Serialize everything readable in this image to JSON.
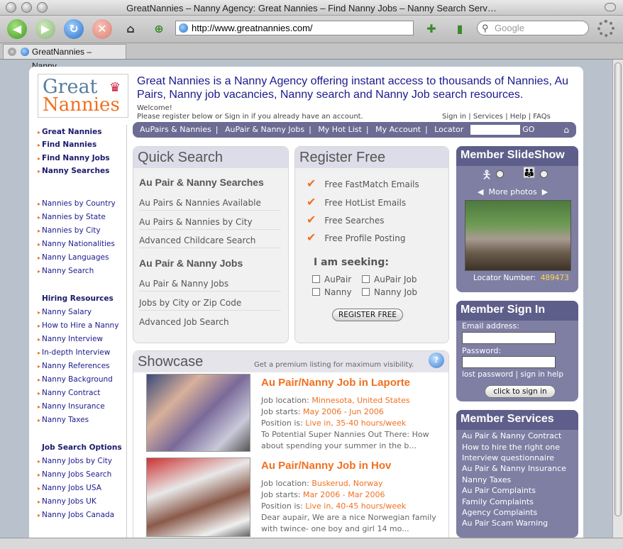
{
  "browser": {
    "window_title": "GreatNannies – Nanny Agency: Great Nannies – Find Nanny Jobs – Nanny Search Serv…",
    "url": "http://www.greatnannies.com/",
    "search_placeholder": "Google",
    "tab_title": "GreatNannies – Nanny…"
  },
  "logo": {
    "line1": "Great",
    "line2": "Nannies"
  },
  "header": {
    "headline": "Great Nannies is a Nanny Agency offering instant access to thousands of Nannies, Au Pairs, Nanny job vacancies, Nanny search and Nanny Job search resources.",
    "welcome": "Welcome!",
    "register_note": "Please register below or Sign in if you already have an account.",
    "top_links": [
      "Sign in",
      "Services",
      "Help",
      "FAQs"
    ]
  },
  "navbar": {
    "items": [
      "AuPairs & Nannies",
      "AuPair & Nanny Jobs",
      "My Hot List",
      "My Account",
      "Locator"
    ],
    "go_label": "GO"
  },
  "leftnav": {
    "main": [
      "Great Nannies",
      "Find Nannies",
      "Find Nanny Jobs",
      "Nanny Searches"
    ],
    "browse": [
      "Nannies by Country",
      "Nannies by State",
      "Nannies by City",
      "Nanny Nationalities",
      "Nanny Languages",
      "Nanny Search"
    ],
    "hiring_header": "Hiring Resources",
    "hiring": [
      "Nanny Salary",
      "How to Hire a Nanny",
      "Nanny Interview",
      "In-depth Interview",
      "Nanny References",
      "Nanny Background",
      "Nanny Contract",
      "Nanny Insurance",
      "Nanny Taxes"
    ],
    "jobs_header": "Job Search Options",
    "jobs": [
      "Nanny Jobs by City",
      "Nanny Jobs Search",
      "Nanny Jobs USA",
      "Nanny Jobs UK",
      "Nanny Jobs Canada"
    ]
  },
  "quick_search": {
    "title": "Quick Search",
    "section1": "Au Pair & Nanny Searches",
    "items1": [
      "Au Pairs & Nannies Available",
      "Au Pairs & Nannies by City",
      "Advanced Childcare Search"
    ],
    "section2": "Au Pair & Nanny Jobs",
    "items2": [
      "Au Pair & Nanny Jobs",
      "Jobs by City or Zip Code",
      "Advanced Job Search"
    ]
  },
  "register": {
    "title": "Register Free",
    "benefits": [
      "Free FastMatch Emails",
      "Free HotList Emails",
      "Free Searches",
      "Free Profile Posting"
    ],
    "seeking_label": "I am seeking:",
    "options": [
      "AuPair",
      "AuPair Job",
      "Nanny",
      "Nanny Job"
    ],
    "button": "REGISTER FREE"
  },
  "showcase": {
    "title": "Showcase",
    "premium_note": "Get a premium listing for maximum visibility.",
    "labels": {
      "location": "Job location:",
      "starts": "Job starts:",
      "position": "Position is:"
    },
    "jobs": [
      {
        "title": "Au Pair/Nanny Job  in Laporte",
        "location": "Minnesota, United States",
        "starts": "May 2006 - Jun 2006",
        "position": "Live in, 35-40 hours/week",
        "desc1": "To Potential Super Nannies Out There: How",
        "desc2": "about spending your summer in the b..."
      },
      {
        "title": "Au Pair/Nanny Job  in Hov",
        "location": "Buskerud, Norway",
        "starts": "Mar 2006 - Mar 2006",
        "position": "Live in, 40-45 hours/week",
        "desc1": "Dear aupair, We are a nice Norwegian family",
        "desc2": "with twince- one boy and girl 14 mo..."
      }
    ]
  },
  "slideshow": {
    "title": "Member SlideShow",
    "more_photos": "More photos",
    "locator_label": "Locator Number:",
    "locator_number": "489473"
  },
  "signin": {
    "title": "Member Sign In",
    "email_label": "Email address:",
    "password_label": "Password:",
    "links": [
      "lost password",
      "sign in help"
    ],
    "button": "click to sign in"
  },
  "services": {
    "title": "Member Services",
    "items": [
      "Au Pair & Nanny Contract",
      "How to hire the right one",
      "Interview questionnaire",
      "Au Pair & Nanny Insurance",
      "Nanny Taxes",
      "Au Pair Complaints",
      "Family Complaints",
      "Agency Complaints",
      "Au Pair Scam Warning"
    ]
  }
}
